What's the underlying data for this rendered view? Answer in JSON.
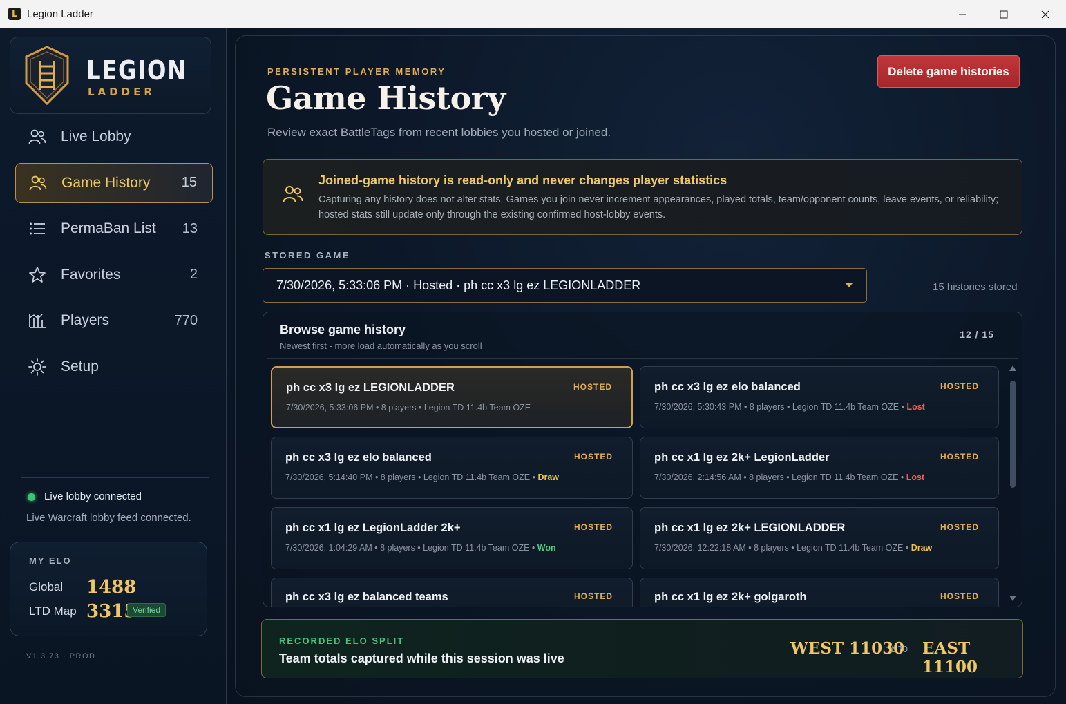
{
  "window": {
    "title": "Legion Ladder",
    "app_icon": "legion-ladder-app-icon",
    "controls": [
      "minimize-icon",
      "maximize-icon",
      "close-icon"
    ]
  },
  "logo": {
    "line1": "LEGION",
    "line2": "LADDER"
  },
  "nav": {
    "items": [
      {
        "label": "Live Lobby",
        "count": "",
        "icon": "users-icon",
        "active": false
      },
      {
        "label": "Game History",
        "count": "15",
        "icon": "users-icon",
        "active": true
      },
      {
        "label": "PermaBan List",
        "count": "13",
        "icon": "list-icon",
        "active": false
      },
      {
        "label": "Favorites",
        "count": "2",
        "icon": "star-icon",
        "active": false
      },
      {
        "label": "Players",
        "count": "770",
        "icon": "bar-chart-icon",
        "active": false
      },
      {
        "label": "Setup",
        "count": "",
        "icon": "gear-icon",
        "active": false
      }
    ]
  },
  "connection": {
    "status": "Live lobby connected",
    "detail": "Live Warcraft lobby feed connected.",
    "status_color": "#3ec46d"
  },
  "my_elo": {
    "heading": "MY ELO",
    "global_label": "Global",
    "global_value": "1488",
    "map_label": "LTD Map",
    "map_value": "3315",
    "badge": "Verified"
  },
  "version": "V1.3.73 · PROD",
  "header": {
    "eyebrow": "PERSISTENT PLAYER MEMORY",
    "title": "Game History",
    "subtitle": "Review exact BattleTags from recent lobbies you hosted or joined.",
    "delete_button": "Delete game histories"
  },
  "notice": {
    "title": "Joined-game history is read-only and never changes player statistics",
    "body": "Capturing any history does not alter stats. Games you join never increment appearances, played totals, team/opponent counts, leave events, or reliability; hosted stats still update only through the existing confirmed host-lobby events."
  },
  "stored_game": {
    "label": "STORED GAME",
    "selected": "7/30/2026, 5:33:06 PM · Hosted · ph cc x3 lg ez LEGIONLADDER",
    "count_text": "15 histories stored"
  },
  "browse": {
    "title": "Browse game history",
    "subtitle": "Newest first - more load automatically as you scroll",
    "counter": "12 / 15",
    "games": [
      {
        "title": "ph cc x3 lg ez LEGIONLADDER",
        "meta": "7/30/2026, 5:33:06 PM  •  8 players  •  Legion TD 11.4b Team OZE",
        "result": "",
        "tag": "HOSTED",
        "selected": true
      },
      {
        "title": "ph cc x3 lg ez elo balanced",
        "meta": "7/30/2026, 5:30:43 PM  •  8 players  •  Legion TD 11.4b Team OZE  •",
        "result": "Lost",
        "tag": "HOSTED",
        "selected": false
      },
      {
        "title": "ph cc x3 lg ez elo balanced",
        "meta": "7/30/2026, 5:14:40 PM  •  8 players  •  Legion TD 11.4b Team OZE  •",
        "result": "Draw",
        "tag": "HOSTED",
        "selected": false
      },
      {
        "title": "ph cc x1 lg ez 2k+ LegionLadder",
        "meta": "7/30/2026, 2:14:56 AM  •  8 players  •  Legion TD 11.4b Team OZE  •",
        "result": "Lost",
        "tag": "HOSTED",
        "selected": false
      },
      {
        "title": "ph cc x1 lg ez LegionLadder 2k+",
        "meta": "7/30/2026, 1:04:29 AM  •  8 players  •  Legion TD 11.4b Team OZE  •",
        "result": "Won",
        "tag": "HOSTED",
        "selected": false
      },
      {
        "title": "ph cc x1 lg ez 2k+ LEGIONLADDER",
        "meta": "7/30/2026, 12:22:18 AM  •  8 players  •  Legion TD 11.4b Team OZE  •",
        "result": "Draw",
        "tag": "HOSTED",
        "selected": false
      },
      {
        "title": "ph cc x3 lg ez balanced teams",
        "meta": "",
        "result": "",
        "tag": "HOSTED",
        "selected": false
      },
      {
        "title": "ph cc x1 lg ez 2k+ golgaroth",
        "meta": "",
        "result": "",
        "tag": "HOSTED",
        "selected": false
      }
    ]
  },
  "elo_split": {
    "label": "RECORDED ELO SPLIT",
    "text": "Team totals captured while this session was live",
    "west": "WEST 11030",
    "delta": "Δ 70",
    "east": "EAST 11100"
  }
}
